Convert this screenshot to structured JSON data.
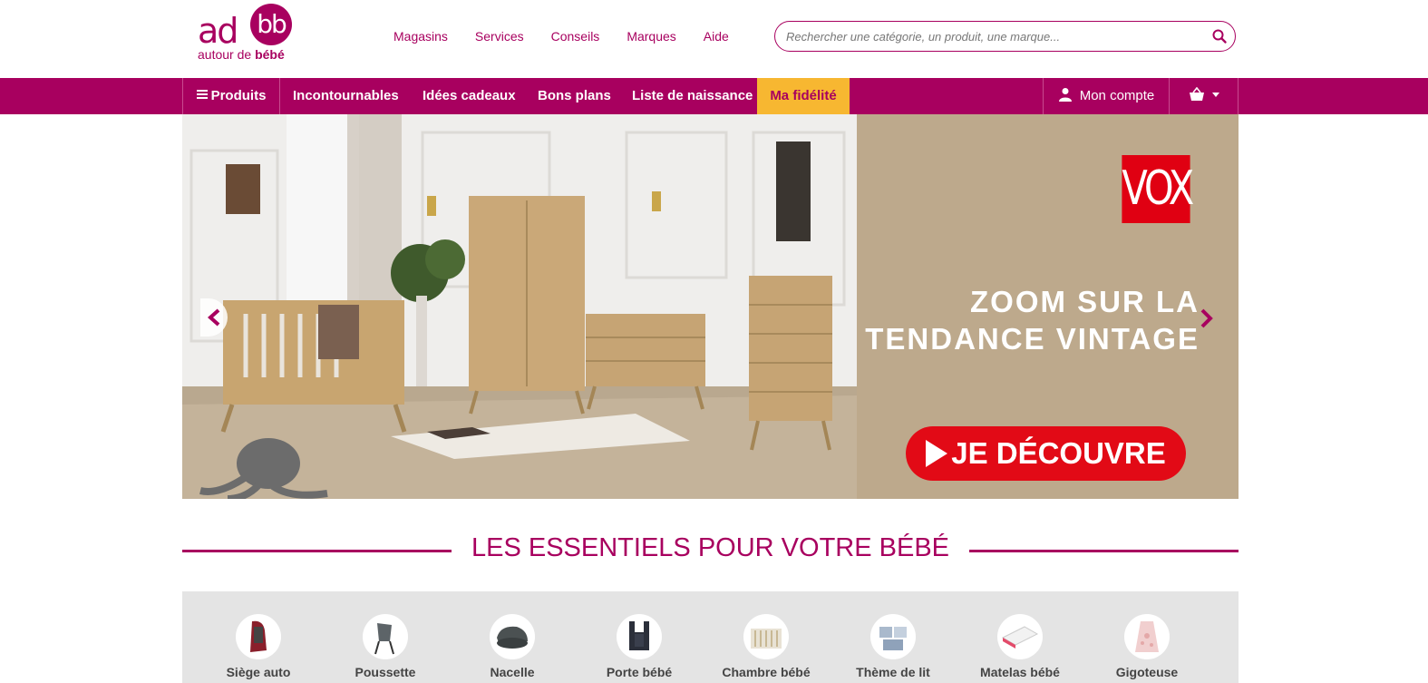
{
  "logo": {
    "ad": "ad",
    "bb": "bb",
    "sub_prefix": "autour de ",
    "sub_bold": "bébé"
  },
  "topnav": [
    "Magasins",
    "Services",
    "Conseils",
    "Marques",
    "Aide"
  ],
  "search": {
    "placeholder": "Rechercher une catégorie, un produit, une marque...",
    "icon": "search-icon"
  },
  "navbar": {
    "produits": "Produits",
    "items": [
      "Incontournables",
      "Idées cadeaux",
      "Bons plans",
      "Liste de naissance"
    ],
    "fidelite": "Ma fidélité",
    "account": "Mon compte",
    "colors": {
      "primary": "#a8005f",
      "fidelite_bg": "#f7b731"
    }
  },
  "hero": {
    "brand": "VOX",
    "title_line1": "ZOOM SUR LA",
    "title_line2": "TENDANCE VINTAGE",
    "cta": "JE DÉCOUVRE",
    "colors": {
      "side_bg": "#bda98c",
      "cta_bg": "#e20a16",
      "brand_bg": "#e00012"
    }
  },
  "section": {
    "title": "LES ESSENTIELS POUR VOTRE BÉBÉ"
  },
  "categories": [
    {
      "label": "Siège auto",
      "icon": "car-seat-icon"
    },
    {
      "label": "Poussette",
      "icon": "stroller-icon"
    },
    {
      "label": "Nacelle",
      "icon": "bassinet-icon"
    },
    {
      "label": "Porte bébé",
      "icon": "baby-carrier-icon"
    },
    {
      "label": "Chambre bébé",
      "icon": "crib-icon"
    },
    {
      "label": "Thème de lit",
      "icon": "bedding-icon"
    },
    {
      "label": "Matelas bébé",
      "icon": "mattress-icon"
    },
    {
      "label": "Gigoteuse",
      "icon": "sleeping-bag-icon"
    }
  ]
}
